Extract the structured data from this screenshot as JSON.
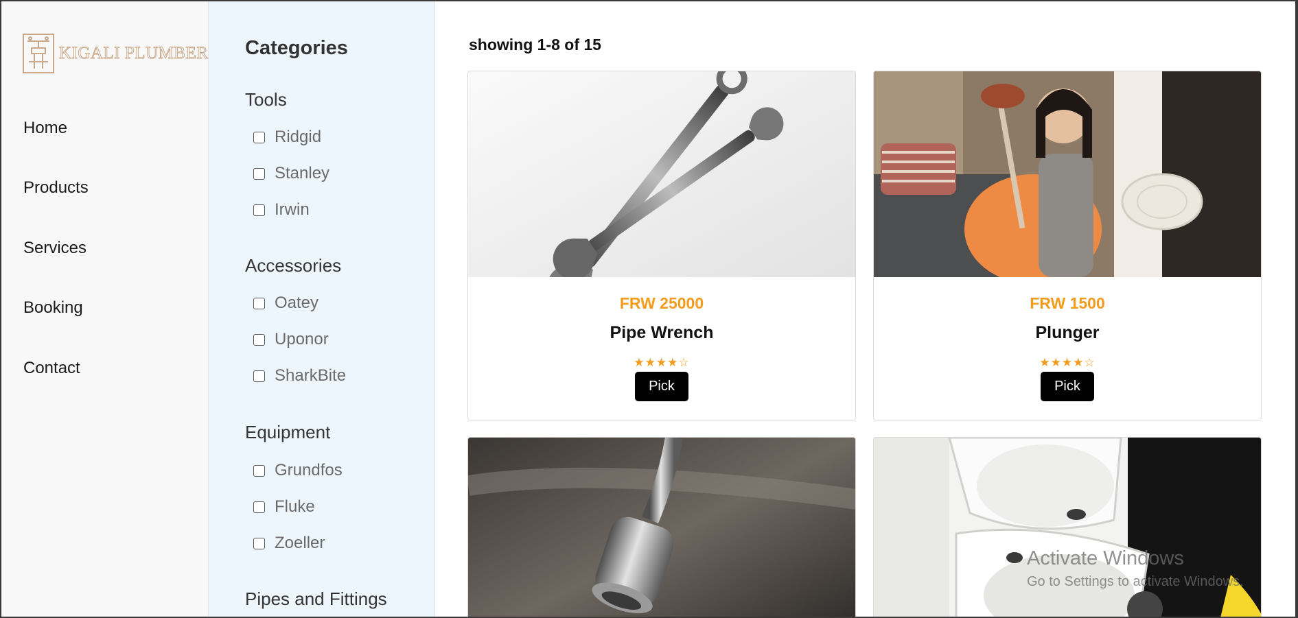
{
  "brand": {
    "name": "KIGALI PLUMBERS",
    "logo_icon": "faucet-pipe-logo"
  },
  "nav": {
    "items": [
      {
        "label": "Home"
      },
      {
        "label": "Products"
      },
      {
        "label": "Services"
      },
      {
        "label": "Booking"
      },
      {
        "label": "Contact"
      }
    ]
  },
  "categories": {
    "title": "Categories",
    "groups": [
      {
        "title": "Tools",
        "options": [
          "Ridgid",
          "Stanley",
          "Irwin"
        ]
      },
      {
        "title": "Accessories",
        "options": [
          "Oatey",
          "Uponor",
          "SharkBite"
        ]
      },
      {
        "title": "Equipment",
        "options": [
          "Grundfos",
          "Fluke",
          "Zoeller"
        ]
      },
      {
        "title": "Pipes and Fittings",
        "options": []
      }
    ]
  },
  "results": {
    "showing": "showing 1-8 of 15"
  },
  "products": [
    {
      "price": "FRW 25000",
      "name": "Pipe Wrench",
      "rating": 4,
      "rating_max": 5,
      "stars": "★★★★☆",
      "action": "Pick",
      "image": "wrench-photo"
    },
    {
      "price": "FRW 1500",
      "name": "Plunger",
      "rating": 4,
      "rating_max": 5,
      "stars": "★★★★☆",
      "action": "Pick",
      "image": "plunger-photo"
    },
    {
      "image": "faucet-photo"
    },
    {
      "image": "toilet-photo"
    }
  ],
  "watermark": {
    "line1": "Activate Windows",
    "line2": "Go to Settings to activate Windows."
  },
  "colors": {
    "accent": "#f29b1c",
    "nav_bg": "#f8f8f8",
    "filter_bg": "#eef6fd",
    "button_bg": "#000000"
  }
}
